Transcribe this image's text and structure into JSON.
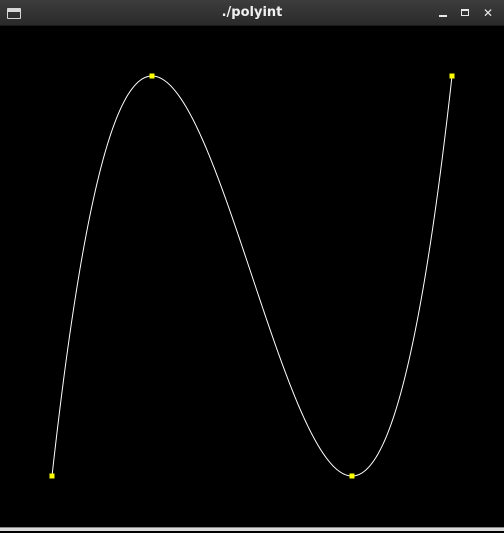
{
  "window": {
    "title": "./polyint"
  },
  "titlebar_icons": {
    "app": "window-icon",
    "minimize": "minimize-icon",
    "maximize": "maximize-icon",
    "close": "close-icon"
  },
  "colors": {
    "background": "#000000",
    "curve": "#ffffff",
    "control_points": "#ffff00"
  },
  "control_points": [
    {
      "x": 0,
      "y": 0
    },
    {
      "x": 1,
      "y": 1
    },
    {
      "x": 3,
      "y": 0
    },
    {
      "x": 4,
      "y": 1
    }
  ]
}
